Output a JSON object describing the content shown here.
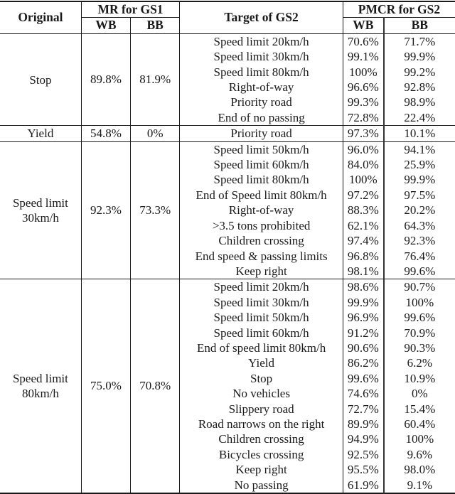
{
  "headers": {
    "original": "Original",
    "mr_group": "MR for GS1",
    "target": "Target of GS2",
    "pmcr_group": "PMCR for GS2",
    "wb": "WB",
    "bb": "BB"
  },
  "groups": [
    {
      "original": "Stop",
      "mr_wb": "89.8%",
      "mr_bb": "81.9%",
      "targets": [
        {
          "name": "Speed limit 20km/h",
          "wb": "70.6%",
          "bb": "71.7%"
        },
        {
          "name": "Speed limit 30km/h",
          "wb": "99.1%",
          "bb": "99.9%"
        },
        {
          "name": "Speed limit 80km/h",
          "wb": "100%",
          "bb": "99.2%"
        },
        {
          "name": "Right-of-way",
          "wb": "96.6%",
          "bb": "92.8%"
        },
        {
          "name": "Priority road",
          "wb": "99.3%",
          "bb": "98.9%"
        },
        {
          "name": "End of no passing",
          "wb": "72.8%",
          "bb": "22.4%"
        }
      ]
    },
    {
      "original": "Yield",
      "mr_wb": "54.8%",
      "mr_bb": "0%",
      "targets": [
        {
          "name": "Priority road",
          "wb": "97.3%",
          "bb": "10.1%"
        }
      ]
    },
    {
      "original": "Speed limit 30km/h",
      "mr_wb": "92.3%",
      "mr_bb": "73.3%",
      "targets": [
        {
          "name": "Speed limit 50km/h",
          "wb": "96.0%",
          "bb": "94.1%"
        },
        {
          "name": "Speed limit 60km/h",
          "wb": "84.0%",
          "bb": "25.9%"
        },
        {
          "name": "Speed limit 80km/h",
          "wb": "100%",
          "bb": "99.9%"
        },
        {
          "name": "End of Speed limit 80km/h",
          "wb": "97.2%",
          "bb": "97.5%"
        },
        {
          "name": "Right-of-way",
          "wb": "88.3%",
          "bb": "20.2%"
        },
        {
          "name": ">3.5 tons prohibited",
          "wb": "62.1%",
          "bb": "64.3%"
        },
        {
          "name": "Children crossing",
          "wb": "97.4%",
          "bb": "92.3%"
        },
        {
          "name": "End speed & passing limits",
          "wb": "96.8%",
          "bb": "76.4%"
        },
        {
          "name": "Keep right",
          "wb": "98.1%",
          "bb": "99.6%"
        }
      ]
    },
    {
      "original": "Speed limit 80km/h",
      "mr_wb": "75.0%",
      "mr_bb": "70.8%",
      "targets": [
        {
          "name": "Speed limit 20km/h",
          "wb": "98.6%",
          "bb": "90.7%"
        },
        {
          "name": "Speed limit 30km/h",
          "wb": "99.9%",
          "bb": "100%"
        },
        {
          "name": "Speed limit 50km/h",
          "wb": "96.9%",
          "bb": "99.6%"
        },
        {
          "name": "Speed limit 60km/h",
          "wb": "91.2%",
          "bb": "70.9%"
        },
        {
          "name": "End of speed limit 80km/h",
          "wb": "90.6%",
          "bb": "90.3%"
        },
        {
          "name": "Yield",
          "wb": "86.2%",
          "bb": "6.2%"
        },
        {
          "name": "Stop",
          "wb": "99.6%",
          "bb": "10.9%"
        },
        {
          "name": "No vehicles",
          "wb": "74.6%",
          "bb": "0%"
        },
        {
          "name": "Slippery road",
          "wb": "72.7%",
          "bb": "15.4%"
        },
        {
          "name": "Road narrows on the right",
          "wb": "89.9%",
          "bb": "60.4%"
        },
        {
          "name": "Children crossing",
          "wb": "94.9%",
          "bb": "100%"
        },
        {
          "name": "Bicycles crossing",
          "wb": "92.5%",
          "bb": "9.6%"
        },
        {
          "name": "Keep right",
          "wb": "95.5%",
          "bb": "98.0%"
        },
        {
          "name": "No passing",
          "wb": "61.9%",
          "bb": "9.1%"
        }
      ]
    }
  ]
}
